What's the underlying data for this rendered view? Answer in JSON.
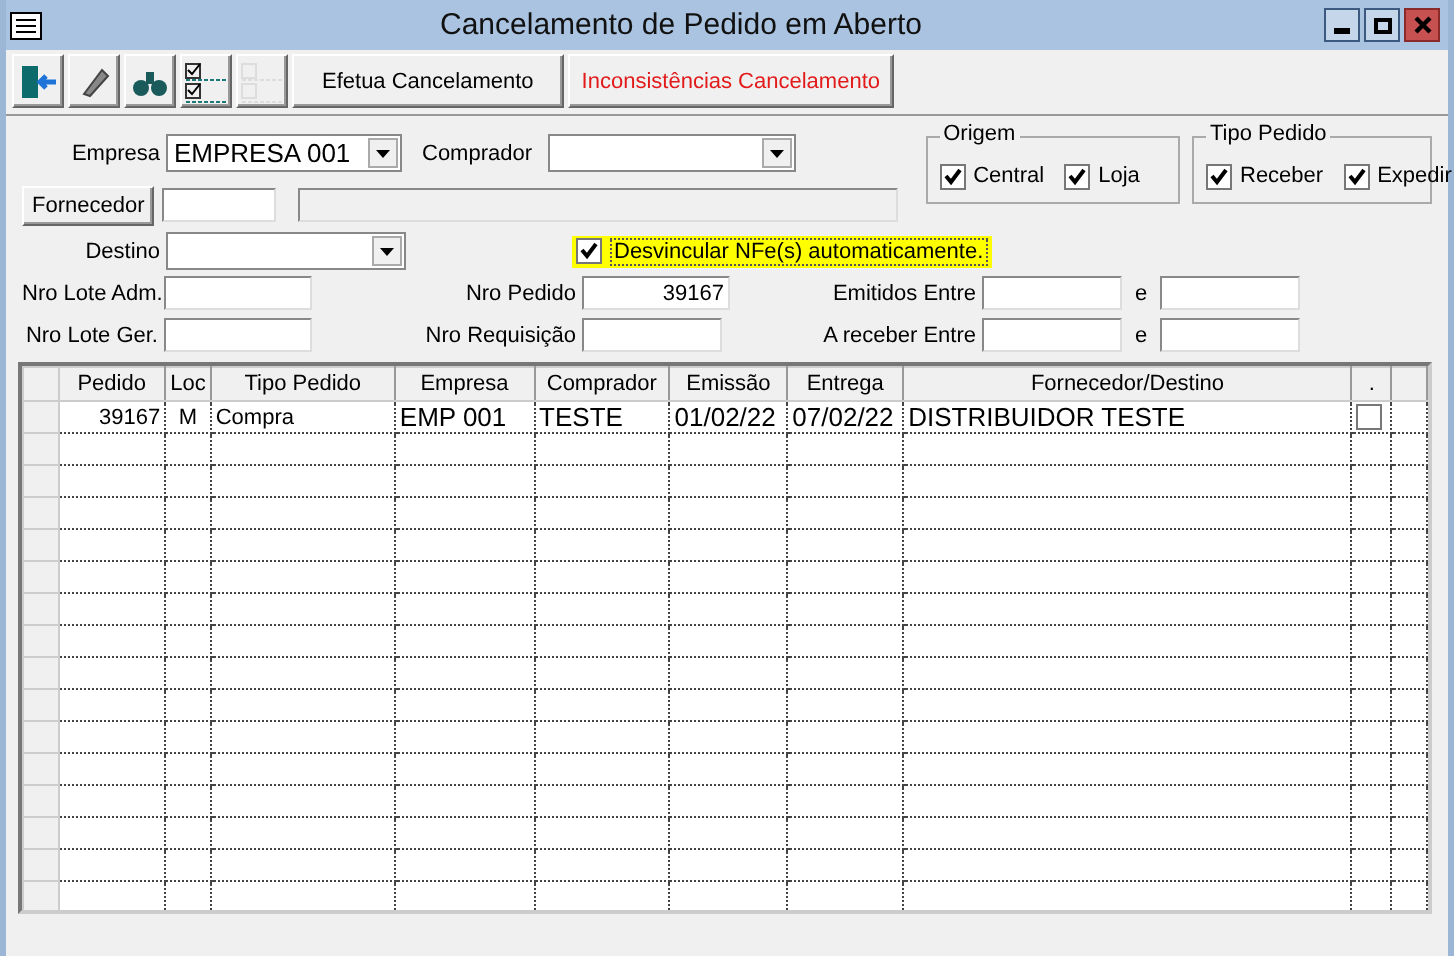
{
  "window": {
    "title": "Cancelamento de Pedido em Aberto"
  },
  "toolbar": {
    "buttons": [
      {
        "kind": "exit",
        "disabled": false
      },
      {
        "kind": "eraser",
        "disabled": false
      },
      {
        "kind": "binoculars",
        "disabled": false
      },
      {
        "kind": "check-all",
        "disabled": false
      },
      {
        "kind": "uncheck-all",
        "disabled": true
      }
    ],
    "text_buttons": [
      {
        "label": "Efetua Cancelamento",
        "kind": "normal"
      },
      {
        "label": "Inconsistências Cancelamento",
        "kind": "alert"
      }
    ]
  },
  "form": {
    "empresa": {
      "label": "Empresa",
      "value": "EMPRESA 001"
    },
    "comprador": {
      "label": "Comprador"
    },
    "fornecedor": {
      "label": "Fornecedor"
    },
    "destino": {
      "label": "Destino"
    },
    "desvincular": {
      "label": "Desvincular NFe(s) automaticamente.",
      "checked": true
    },
    "nro_lote_adm": {
      "label": "Nro Lote Adm."
    },
    "nro_lote_ger": {
      "label": "Nro Lote Ger."
    },
    "nro_pedido": {
      "label": "Nro Pedido",
      "value": "39167"
    },
    "nro_requisicao": {
      "label": "Nro Requisição"
    },
    "emitidos_entre": {
      "label": "Emitidos Entre",
      "and": "e"
    },
    "a_receber_entre": {
      "label": "A receber Entre",
      "and": "e"
    },
    "origem": {
      "title": "Origem",
      "options": [
        {
          "label": "Central",
          "checked": true
        },
        {
          "label": "Loja",
          "checked": true
        }
      ]
    },
    "tipo_pedido": {
      "title": "Tipo Pedido",
      "options": [
        {
          "label": "Receber",
          "checked": true
        },
        {
          "label": "Expedir",
          "checked": true
        }
      ]
    }
  },
  "table": {
    "columns": [
      "Pedido",
      "Loc",
      "Tipo Pedido",
      "Empresa",
      "Comprador",
      "Emissão",
      "Entrega",
      "Fornecedor/Destino",
      "."
    ],
    "rows": [
      {
        "cells": [
          "39167",
          "M",
          "Compra",
          "EMP 001",
          "TESTE",
          "01/02/22",
          "07/02/22",
          "DISTRIBUIDOR TESTE"
        ],
        "checked": false
      }
    ]
  }
}
